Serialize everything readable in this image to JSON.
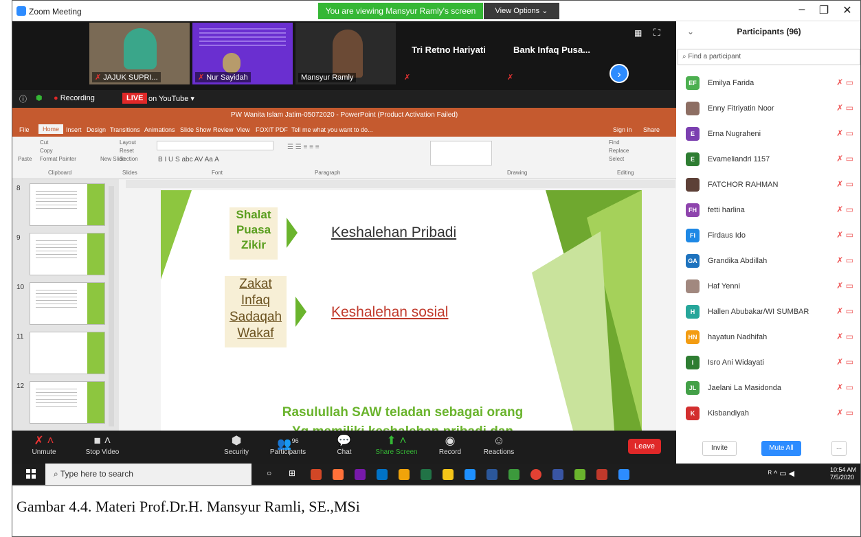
{
  "window": {
    "title": "Zoom Meeting",
    "viewing_banner": "You are viewing Mansyur Ramly's screen",
    "view_options": "View Options ⌄",
    "minimize": "–",
    "maximize": "❐",
    "close": "✕"
  },
  "videos": [
    {
      "name": "JAJUK SUPRI...",
      "type": "video"
    },
    {
      "name": "Nur Sayidah",
      "type": "video"
    },
    {
      "name": "Mansyur Ramly",
      "type": "video"
    },
    {
      "name": "Tri Retno Hariyati",
      "type": "name"
    },
    {
      "name": "Bank Infaq Pusa...",
      "type": "name"
    }
  ],
  "recording": {
    "label": "Recording",
    "live": "LIVE",
    "platform": "on YouTube ▾"
  },
  "powerpoint": {
    "title": "PW Wanita Islam Jatim-05072020 - PowerPoint (Product Activation Failed)",
    "menu": [
      "File",
      "Home",
      "Insert",
      "Design",
      "Transitions",
      "Animations",
      "Slide Show",
      "Review",
      "View",
      "FOXIT PDF",
      "Tell me what you want to do..."
    ],
    "sign_in": "Sign in",
    "share": "Share",
    "ribbon_groups": [
      "Clipboard",
      "Slides",
      "Font",
      "Paragraph",
      "Drawing",
      "Editing"
    ],
    "ribbon_items": {
      "cut": "Cut",
      "copy": "Copy",
      "format_painter": "Format Painter",
      "paste": "Paste",
      "layout": "Layout",
      "reset": "Reset",
      "new_slide": "New Slide",
      "section": "Section",
      "find": "Find",
      "replace": "Replace",
      "select": "Select"
    },
    "thumb_numbers": [
      "8",
      "9",
      "10",
      "11",
      "12"
    ]
  },
  "slide": {
    "box1": [
      "Shalat",
      "Puasa",
      "Zikir"
    ],
    "target1": "Keshalehan Pribadi",
    "box2": [
      "Zakat",
      "Infaq",
      "Sadaqah",
      "Wakaf"
    ],
    "target2": "Keshalehan sosial",
    "footer_line1": "Rasulullah SAW teladan sebagai orang",
    "footer_line2": "Yg memiliki keshalehan pribadi dan"
  },
  "toolbar": {
    "unmute": "Unmute",
    "stop_video": "Stop Video",
    "security": "Security",
    "participants": "Participants",
    "participants_count": "96",
    "chat": "Chat",
    "share_screen": "Share Screen",
    "record": "Record",
    "reactions": "Reactions",
    "leave": "Leave"
  },
  "panel": {
    "title": "Participants (96)",
    "search_placeholder": "Find a participant",
    "participants": [
      {
        "initials": "EF",
        "name": "Emilya Farida",
        "color": "#4caf50"
      },
      {
        "initials": "",
        "name": "Enny Fitriyatin Noor",
        "color": "#8d6e63"
      },
      {
        "initials": "E",
        "name": "Erna Nugraheni",
        "color": "#7b3fb0"
      },
      {
        "initials": "E",
        "name": "Evameliandri 1157",
        "color": "#2e7d32"
      },
      {
        "initials": "",
        "name": "FATCHOR RAHMAN",
        "color": "#5d4037"
      },
      {
        "initials": "FH",
        "name": "fetti harlina",
        "color": "#8e44ad"
      },
      {
        "initials": "FI",
        "name": "Firdaus Ido",
        "color": "#1e88e5"
      },
      {
        "initials": "GA",
        "name": "Grandika Abdillah",
        "color": "#1e73be"
      },
      {
        "initials": "",
        "name": "Haf Yenni",
        "color": "#a1887f"
      },
      {
        "initials": "H",
        "name": "Hallen Abubakar/WI SUMBAR",
        "color": "#26a69a"
      },
      {
        "initials": "HN",
        "name": "hayatun Nadhifah",
        "color": "#f39c12"
      },
      {
        "initials": "I",
        "name": "Isro Ani Widayati",
        "color": "#2e7d32"
      },
      {
        "initials": "JL",
        "name": "Jaelani La Masidonda",
        "color": "#43a047"
      },
      {
        "initials": "K",
        "name": "Kisbandiyah",
        "color": "#d32f2f"
      }
    ],
    "invite": "Invite",
    "mute_all": "Mute All",
    "more": "..."
  },
  "taskbar": {
    "search_placeholder": "Type here to search",
    "time": "10:54 AM",
    "date": "7/5/2020"
  },
  "caption": "Gambar 4.4. Materi Prof.Dr.H. Mansyur Ramli, SE.,MSi"
}
